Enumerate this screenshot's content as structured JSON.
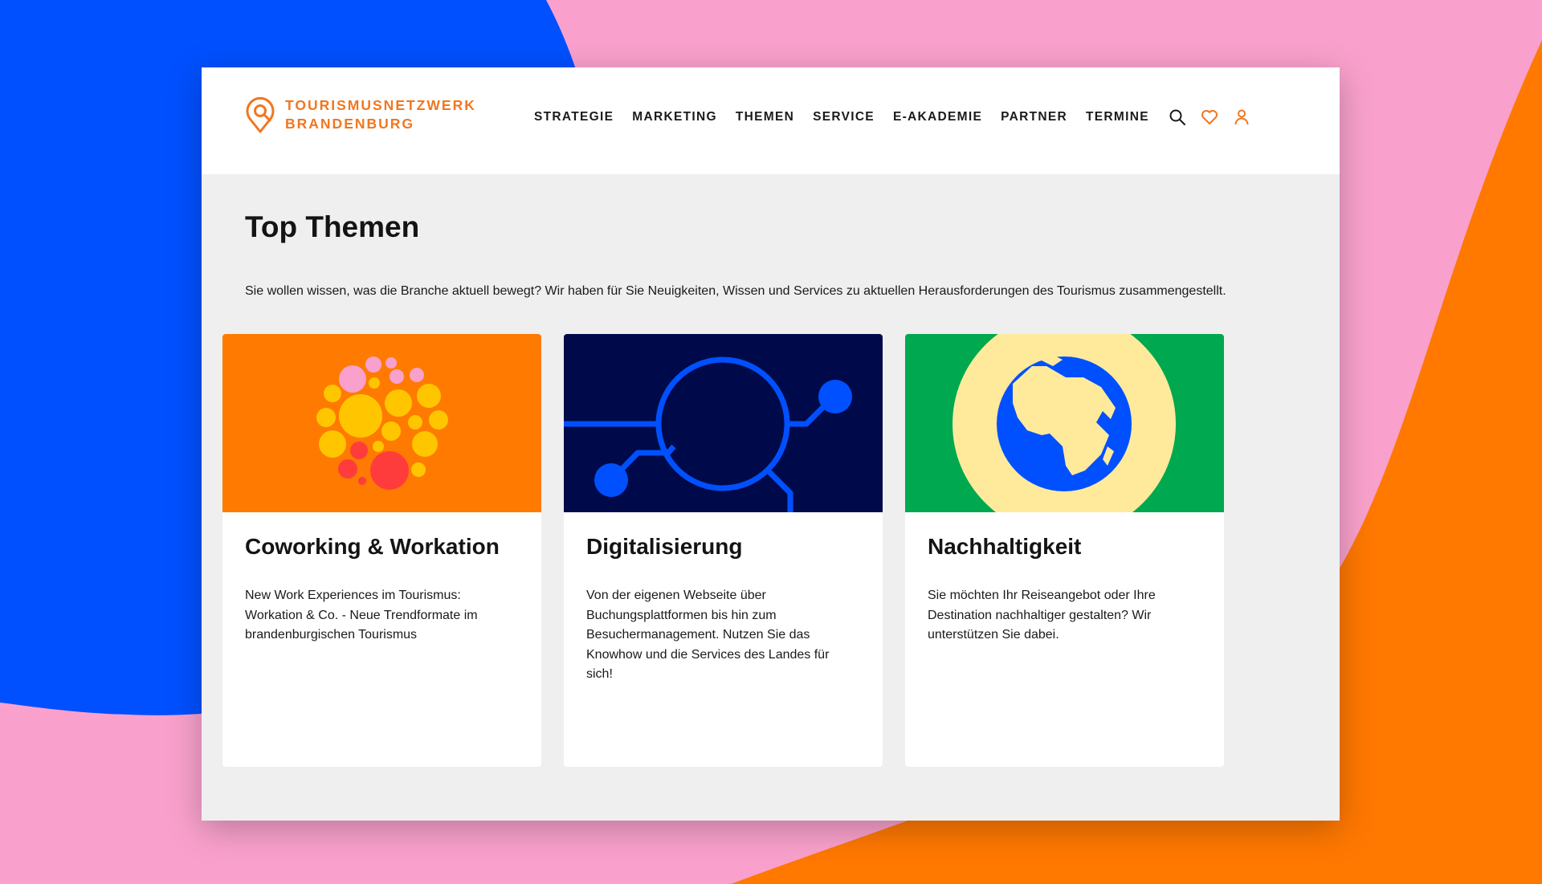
{
  "brand": {
    "line1": "TOURISMUSNETZWERK",
    "line2": "BRANDENBURG",
    "color": "#f2761f"
  },
  "nav": {
    "items": [
      "STRATEGIE",
      "MARKETING",
      "THEMEN",
      "SERVICE",
      "E-AKADEMIE",
      "PARTNER",
      "TERMINE"
    ],
    "icons": [
      "search-icon",
      "heart-icon",
      "user-icon"
    ]
  },
  "page": {
    "title": "Top Themen",
    "intro": "Sie wollen wissen, was die Branche aktuell bewegt? Wir haben für Sie Neuigkeiten, Wissen und Services zu aktuellen Herausforderungen des Tourismus zusammengestellt."
  },
  "cards": [
    {
      "title": "Coworking & Workation",
      "text": "New Work Experiences im Tourismus: Workation & Co. - Neue Trendformate im brandenburgischen Tourismus",
      "image_bg": "#ff7a00"
    },
    {
      "title": "Digitalisierung",
      "text": "Von der eigenen Webseite über Buchungsplattformen bis hin zum Besuchermanagement. Nutzen Sie das Knowhow und die Services des Landes für sich!",
      "image_bg": "#000a4a"
    },
    {
      "title": "Nachhaltigkeit",
      "text": "Sie möchten Ihr Reiseangebot oder Ihre Destination nachhaltiger gestalten? Wir unterstützen Sie dabei.",
      "image_bg": "#00a84f"
    }
  ],
  "colors": {
    "background_pink": "#f9a1cc",
    "background_blue": "#0050ff",
    "background_orange": "#ff7800",
    "accent": "#f2761f"
  }
}
